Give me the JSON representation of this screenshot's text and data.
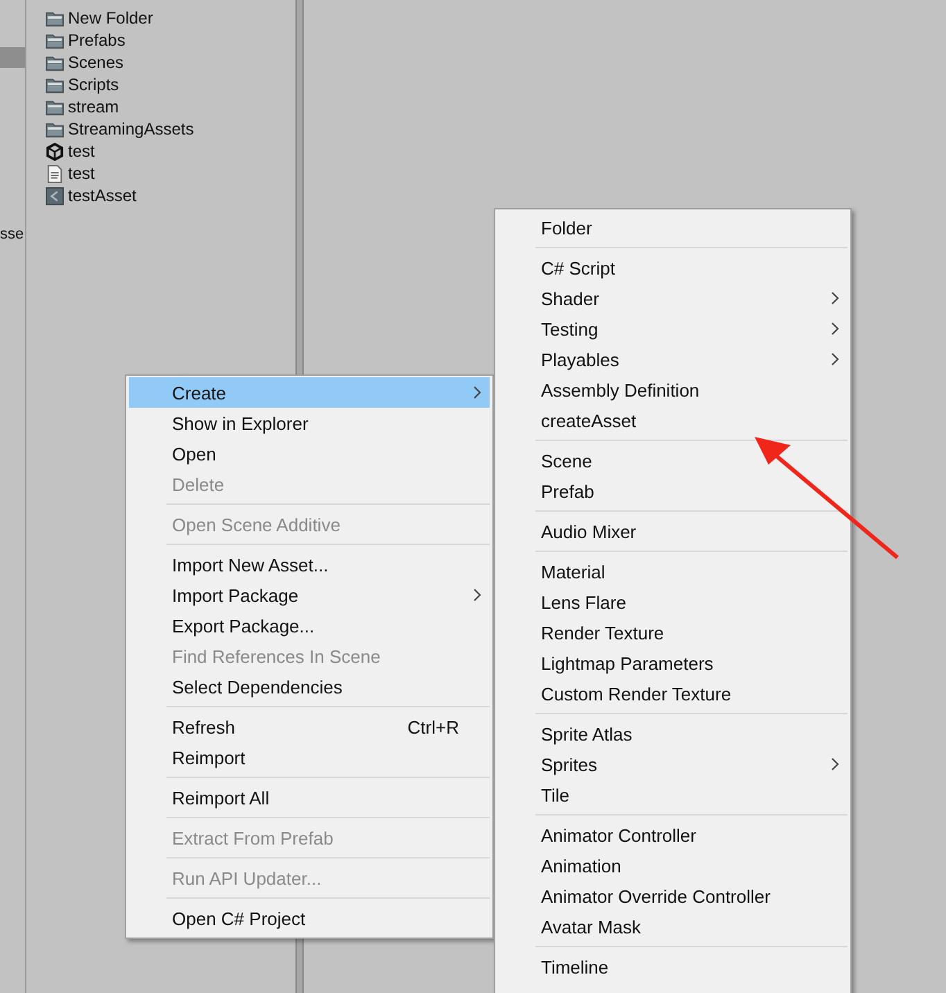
{
  "left_panel": {
    "selected_row": true,
    "cut_label": "sse"
  },
  "files": [
    {
      "name": "New Folder",
      "kind": "folder"
    },
    {
      "name": "Prefabs",
      "kind": "folder"
    },
    {
      "name": "Scenes",
      "kind": "folder"
    },
    {
      "name": "Scripts",
      "kind": "folder"
    },
    {
      "name": "stream",
      "kind": "folder"
    },
    {
      "name": "StreamingAssets",
      "kind": "folder"
    },
    {
      "name": "test",
      "kind": "unity"
    },
    {
      "name": "test",
      "kind": "text"
    },
    {
      "name": "testAsset",
      "kind": "asset"
    }
  ],
  "context_menu": [
    [
      {
        "label": "Create",
        "disabled": false,
        "selected": true,
        "submenu": true
      },
      {
        "label": "Show in Explorer",
        "disabled": false,
        "selected": false,
        "submenu": false
      },
      {
        "label": "Open",
        "disabled": false,
        "selected": false,
        "submenu": false
      },
      {
        "label": "Delete",
        "disabled": true,
        "selected": false,
        "submenu": false
      }
    ],
    [
      {
        "label": "Open Scene Additive",
        "disabled": true,
        "selected": false,
        "submenu": false
      }
    ],
    [
      {
        "label": "Import New Asset...",
        "disabled": false,
        "selected": false,
        "submenu": false
      },
      {
        "label": "Import Package",
        "disabled": false,
        "selected": false,
        "submenu": true
      },
      {
        "label": "Export Package...",
        "disabled": false,
        "selected": false,
        "submenu": false
      },
      {
        "label": "Find References In Scene",
        "disabled": true,
        "selected": false,
        "submenu": false
      },
      {
        "label": "Select Dependencies",
        "disabled": false,
        "selected": false,
        "submenu": false
      }
    ],
    [
      {
        "label": "Refresh",
        "disabled": false,
        "selected": false,
        "submenu": false,
        "shortcut": "Ctrl+R"
      },
      {
        "label": "Reimport",
        "disabled": false,
        "selected": false,
        "submenu": false
      }
    ],
    [
      {
        "label": "Reimport All",
        "disabled": false,
        "selected": false,
        "submenu": false
      }
    ],
    [
      {
        "label": "Extract From Prefab",
        "disabled": true,
        "selected": false,
        "submenu": false
      }
    ],
    [
      {
        "label": "Run API Updater...",
        "disabled": true,
        "selected": false,
        "submenu": false
      }
    ],
    [
      {
        "label": "Open C# Project",
        "disabled": false,
        "selected": false,
        "submenu": false
      }
    ]
  ],
  "create_submenu": [
    [
      {
        "label": "Folder",
        "disabled": false,
        "selected": false,
        "submenu": false
      }
    ],
    [
      {
        "label": "C# Script",
        "disabled": false,
        "selected": false,
        "submenu": false
      },
      {
        "label": "Shader",
        "disabled": false,
        "selected": false,
        "submenu": true
      },
      {
        "label": "Testing",
        "disabled": false,
        "selected": false,
        "submenu": true
      },
      {
        "label": "Playables",
        "disabled": false,
        "selected": false,
        "submenu": true
      },
      {
        "label": "Assembly Definition",
        "disabled": false,
        "selected": false,
        "submenu": false
      },
      {
        "label": "createAsset",
        "disabled": false,
        "selected": false,
        "submenu": false
      }
    ],
    [
      {
        "label": "Scene",
        "disabled": false,
        "selected": false,
        "submenu": false
      },
      {
        "label": "Prefab",
        "disabled": false,
        "selected": false,
        "submenu": false
      }
    ],
    [
      {
        "label": "Audio Mixer",
        "disabled": false,
        "selected": false,
        "submenu": false
      }
    ],
    [
      {
        "label": "Material",
        "disabled": false,
        "selected": false,
        "submenu": false
      },
      {
        "label": "Lens Flare",
        "disabled": false,
        "selected": false,
        "submenu": false
      },
      {
        "label": "Render Texture",
        "disabled": false,
        "selected": false,
        "submenu": false
      },
      {
        "label": "Lightmap Parameters",
        "disabled": false,
        "selected": false,
        "submenu": false
      },
      {
        "label": "Custom Render Texture",
        "disabled": false,
        "selected": false,
        "submenu": false
      }
    ],
    [
      {
        "label": "Sprite Atlas",
        "disabled": false,
        "selected": false,
        "submenu": false
      },
      {
        "label": "Sprites",
        "disabled": false,
        "selected": false,
        "submenu": true
      },
      {
        "label": "Tile",
        "disabled": false,
        "selected": false,
        "submenu": false
      }
    ],
    [
      {
        "label": "Animator Controller",
        "disabled": false,
        "selected": false,
        "submenu": false
      },
      {
        "label": "Animation",
        "disabled": false,
        "selected": false,
        "submenu": false
      },
      {
        "label": "Animator Override Controller",
        "disabled": false,
        "selected": false,
        "submenu": false
      },
      {
        "label": "Avatar Mask",
        "disabled": false,
        "selected": false,
        "submenu": false
      }
    ],
    [
      {
        "label": "Timeline",
        "disabled": false,
        "selected": false,
        "submenu": false
      }
    ]
  ]
}
